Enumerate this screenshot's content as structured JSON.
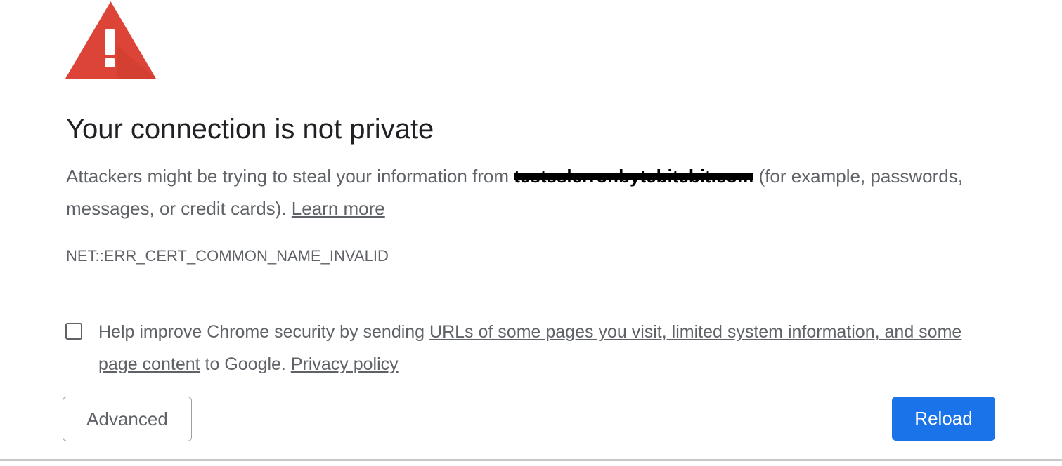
{
  "interstitial": {
    "heading": "Your connection is not private",
    "explanation_before": "Attackers might be trying to steal your information from ",
    "redacted_host": "testsslerror.bytebitebit.com",
    "explanation_after": " (for example, passwords, messages, or credit cards). ",
    "learn_more": "Learn more",
    "error_code": "NET::ERR_CERT_COMMON_NAME_INVALID"
  },
  "opt_in": {
    "checked": false,
    "text_before": "Help improve Chrome security by sending ",
    "link_text": "URLs of some pages you visit, limited system information, and some page content",
    "text_middle": " to Google. ",
    "privacy_link": "Privacy policy"
  },
  "buttons": {
    "advanced_label": "Advanced",
    "reload_label": "Reload"
  },
  "icons": {
    "warning": "warning-triangle-icon"
  },
  "colors": {
    "warning_red": "#db4437",
    "primary_blue": "#1a73e8",
    "heading_text": "#202124",
    "body_text": "#5f6368"
  }
}
